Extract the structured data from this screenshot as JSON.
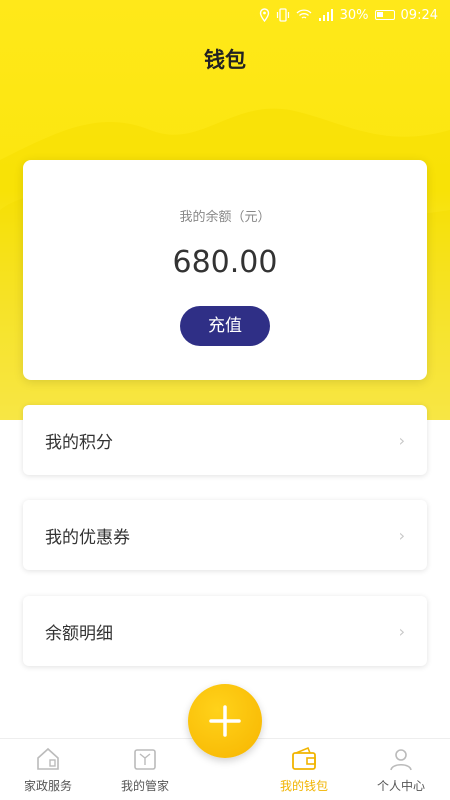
{
  "status_bar": {
    "battery": "30%",
    "time": "09:24"
  },
  "header": {
    "title": "钱包"
  },
  "balance": {
    "label": "我的余额（元）",
    "amount": "680.00",
    "recharge_label": "充值"
  },
  "menu": [
    {
      "label": "我的积分"
    },
    {
      "label": "我的优惠券"
    },
    {
      "label": "余额明细"
    }
  ],
  "tabbar": {
    "items": [
      {
        "label": "家政服务",
        "icon": "home-icon"
      },
      {
        "label": "我的管家",
        "icon": "butler-icon"
      },
      {
        "label": "我的钱包",
        "icon": "wallet-icon",
        "active": true
      },
      {
        "label": "个人中心",
        "icon": "person-icon"
      }
    ],
    "center_icon": "plus-icon"
  },
  "colors": {
    "accent_yellow": "#f7b500",
    "header_yellow": "#ffe81a",
    "button_navy": "#2f2f86"
  }
}
